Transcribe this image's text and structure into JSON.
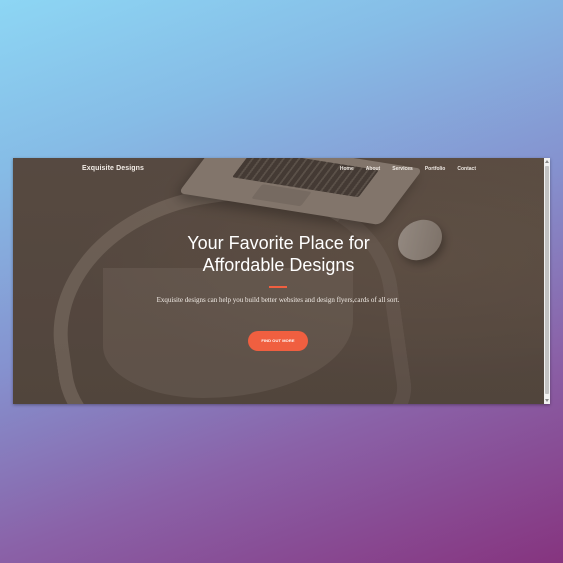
{
  "site": {
    "brand": "Exquisite Designs"
  },
  "nav": {
    "items": [
      {
        "label": "Home"
      },
      {
        "label": "About"
      },
      {
        "label": "Services"
      },
      {
        "label": "Portfolio"
      },
      {
        "label": "Contact"
      }
    ]
  },
  "hero": {
    "headline_line1": "Your Favorite Place for",
    "headline_line2": "Affordable Designs",
    "subtext": "Exquisite designs can help you build better websites and design flyers,cards of all sort.",
    "cta_label": "FIND OUT MORE"
  },
  "colors": {
    "accent": "#f05f40",
    "overlay": "#574a41",
    "text": "#ffffff"
  }
}
